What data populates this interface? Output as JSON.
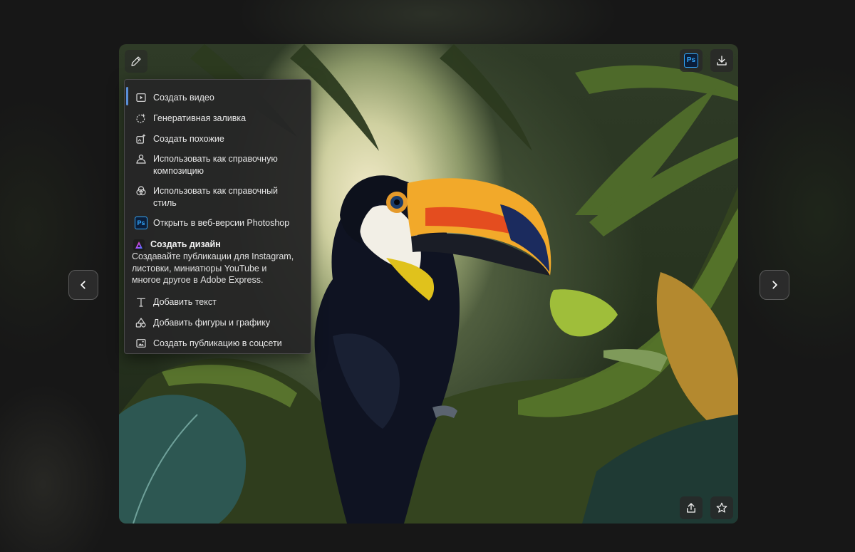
{
  "toolbar": {
    "edit_icon": "pencil-icon",
    "photoshop_badge": "Ps",
    "download_icon": "download-icon",
    "share_icon": "share-icon",
    "favorite_icon": "star-icon"
  },
  "navigation": {
    "prev_icon": "chevron-left-icon",
    "next_icon": "chevron-right-icon"
  },
  "menu": {
    "items": [
      {
        "label": "Создать видео",
        "icon": "play-video-icon"
      },
      {
        "label": "Генеративная заливка",
        "icon": "generative-fill-icon"
      },
      {
        "label": "Создать похожие",
        "icon": "generate-similar-icon"
      },
      {
        "label": "Использовать как справочную композицию",
        "line1": "Использовать как справочную",
        "line2": "композицию",
        "icon": "composition-reference-icon"
      },
      {
        "label": "Использовать как справочный стиль",
        "line1": "Использовать как справочный",
        "line2": "стиль",
        "icon": "style-reference-icon"
      },
      {
        "label": "Открыть в веб-версии Photoshop",
        "icon": "photoshop-icon",
        "badge": "Ps"
      }
    ],
    "express": {
      "title": "Создать дизайн",
      "description": "Создавайте публикации для Instagram, листовки, миниатюры YouTube и многое другое в Adobe Express.",
      "line1": "Создавайте публикации для Instagram,",
      "line2": "листовки, миниатюры YouTube и",
      "line3": "многое другое в Adobe Express.",
      "icon": "adobe-express-icon"
    },
    "express_items": [
      {
        "label": "Добавить текст",
        "icon": "text-icon"
      },
      {
        "label": "Добавить фигуры и графику",
        "icon": "shapes-icon"
      },
      {
        "label": "Создать публикацию в соцсети",
        "icon": "image-post-icon"
      }
    ]
  },
  "colors": {
    "accent": "#5a8fd6",
    "photoshop_blue": "#31a8ff",
    "menu_bg": "#262626"
  }
}
